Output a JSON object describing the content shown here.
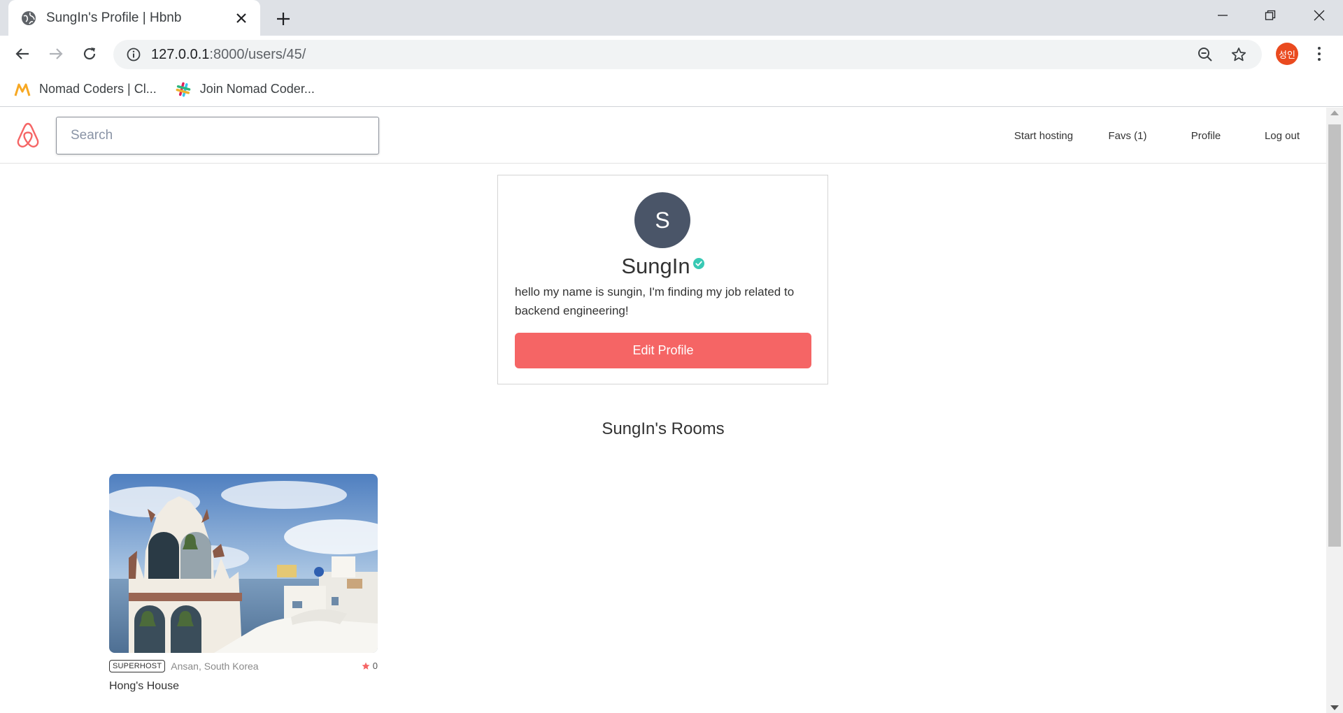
{
  "browser": {
    "tab_title": "SungIn's Profile | Hbnb",
    "url_host": "127.0.0.1",
    "url_path": ":8000/users/45/",
    "profile_initials": "성인",
    "bookmarks": [
      {
        "label": "Nomad Coders | Cl...",
        "icon": "nomad-coders-icon"
      },
      {
        "label": "Join Nomad Coder...",
        "icon": "slack-icon"
      }
    ]
  },
  "site": {
    "search_placeholder": "Search",
    "nav": {
      "start_hosting": "Start hosting",
      "favs": "Favs (1)",
      "profile": "Profile",
      "logout": "Log out"
    },
    "brand_color": "#f56565"
  },
  "profile": {
    "avatar_letter": "S",
    "name": "SungIn",
    "verified": true,
    "bio": "hello my name is sungin, I'm finding my job related to backend engineering!",
    "edit_button": "Edit Profile"
  },
  "rooms": {
    "title": "SungIn's Rooms",
    "items": [
      {
        "badge": "SUPERHOST",
        "location": "Ansan, South Korea",
        "rating": "0",
        "name": "Hong's House"
      }
    ]
  }
}
